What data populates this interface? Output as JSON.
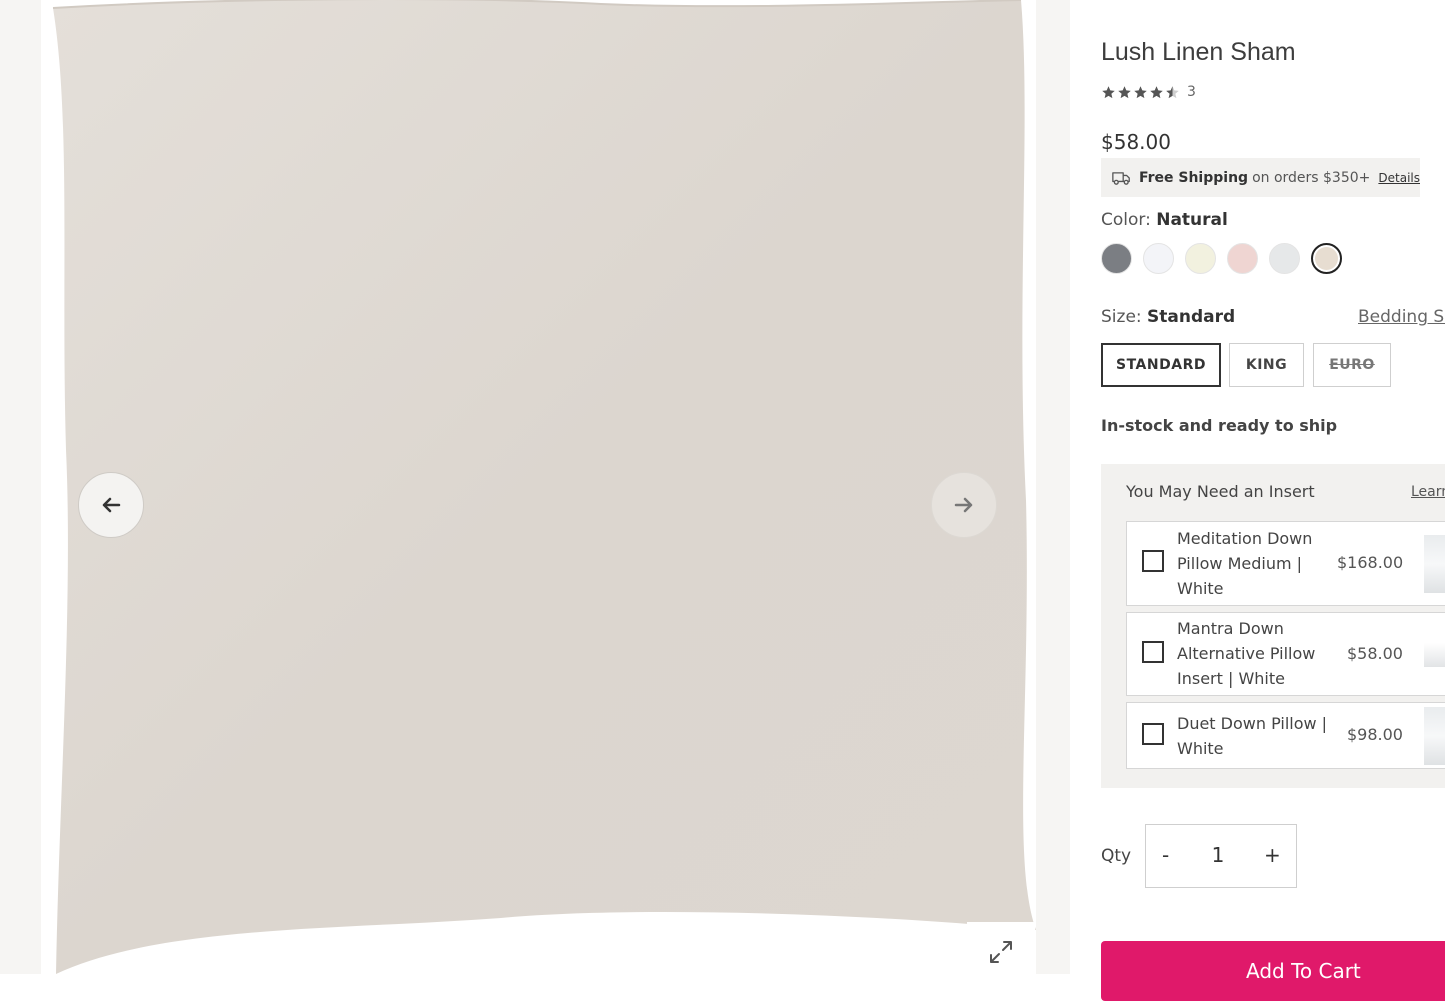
{
  "gallery": {
    "prev_icon": "arrow-left-icon",
    "next_icon": "arrow-right-icon",
    "expand_icon": "expand-icon"
  },
  "product": {
    "title": "Lush Linen Sham",
    "rating": 4.5,
    "rating_max": 5,
    "review_count": "3",
    "price": "$58.00"
  },
  "shipping": {
    "icon": "truck-icon",
    "bold": "Free Shipping",
    "text": "on orders $350+",
    "details_link": "Details"
  },
  "color": {
    "label": "Color:",
    "value": "Natural",
    "swatches": [
      {
        "name": "charcoal",
        "color": "#7b7e83"
      },
      {
        "name": "white",
        "color": "#f3f4f8"
      },
      {
        "name": "ivory",
        "color": "#f2f1df"
      },
      {
        "name": "blush",
        "color": "#efd5d2"
      },
      {
        "name": "mist",
        "color": "#e6e8e9"
      },
      {
        "name": "natural",
        "color": "#e7ddd1",
        "selected": true
      }
    ]
  },
  "size": {
    "label": "Size:",
    "value": "Standard",
    "guide_link": "Bedding Siz",
    "options": [
      {
        "label": "STANDARD",
        "selected": true
      },
      {
        "label": "KING"
      },
      {
        "label": "EURO",
        "unavailable": true
      }
    ]
  },
  "stock_text": "In-stock and ready to ship",
  "inserts": {
    "title": "You May Need an Insert",
    "learn_link": "Learn",
    "items": [
      {
        "name": "Meditation Down Pillow Medium | White",
        "price": "$168.00",
        "checked": false
      },
      {
        "name": "Mantra Down Alternative Pillow Insert | White",
        "price": "$58.00",
        "checked": false
      },
      {
        "name": "Duet Down Pillow | White",
        "price": "$98.00",
        "checked": false
      }
    ]
  },
  "quantity": {
    "label": "Qty",
    "minus": "-",
    "value": "1",
    "plus": "+"
  },
  "add_to_cart": "Add To Cart",
  "colors": {
    "accent": "#e0196a",
    "gallery_bg": "#f6f5f3",
    "panel_tint": "#f2f1ef"
  }
}
